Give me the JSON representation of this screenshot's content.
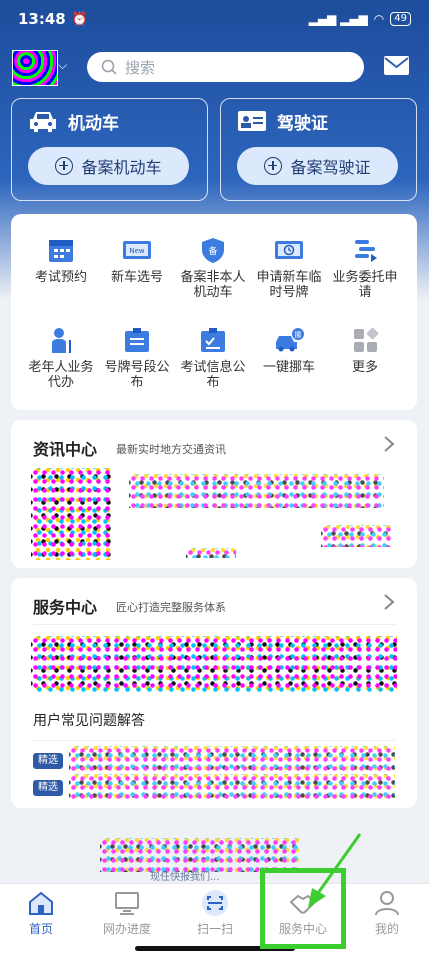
{
  "status_bar": {
    "time": "13:48",
    "signal": "ᐧᐧᐧ ᐧᐧᐧ",
    "battery": "49"
  },
  "search": {
    "placeholder": "搜索"
  },
  "top_cards": {
    "vehicle": {
      "title": "机动车",
      "button": "备案机动车"
    },
    "license": {
      "title": "驾驶证",
      "button": "备案驾驶证"
    }
  },
  "services": [
    {
      "label": "考试预约",
      "icon": "calendar-icon"
    },
    {
      "label": "新车选号",
      "icon": "new-plate-icon"
    },
    {
      "label": "备案非本人机动车",
      "icon": "filing-shield-icon"
    },
    {
      "label": "申请新车临时号牌",
      "icon": "temp-plate-icon"
    },
    {
      "label": "业务委托申请",
      "icon": "delegate-icon"
    },
    {
      "label": "老年人业务代办",
      "icon": "elderly-icon"
    },
    {
      "label": "号牌号段公布",
      "icon": "plate-segment-icon"
    },
    {
      "label": "考试信息公布",
      "icon": "exam-info-icon"
    },
    {
      "label": "一键挪车",
      "icon": "move-car-icon"
    },
    {
      "label": "更多",
      "icon": "more-icon"
    }
  ],
  "news": {
    "title": "资讯中心",
    "subtitle": "最新实时地方交通资讯"
  },
  "service_center": {
    "title": "服务中心",
    "subtitle": "匠心打造完整服务体系",
    "faq": "用户常见问题解答",
    "tags": [
      "精选",
      "精选"
    ]
  },
  "footer_text": "现任快报我们...",
  "bottom_nav": [
    {
      "label": "首页",
      "icon": "home-icon",
      "active": true
    },
    {
      "label": "网办进度",
      "icon": "monitor-icon",
      "active": false
    },
    {
      "label": "扫一扫",
      "icon": "scan-icon",
      "active": false
    },
    {
      "label": "服务中心",
      "icon": "handshake-icon",
      "active": false
    },
    {
      "label": "我的",
      "icon": "user-icon",
      "active": false
    }
  ],
  "colors": {
    "brand": "#2f63c1",
    "highlight": "#3ccd2e"
  }
}
